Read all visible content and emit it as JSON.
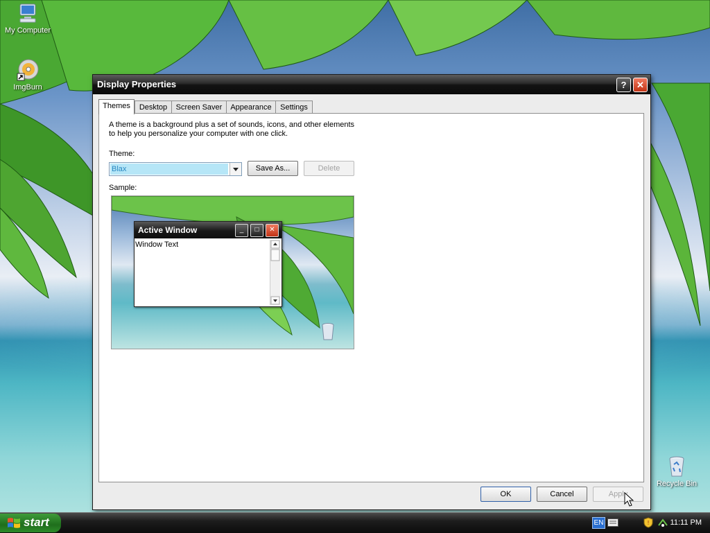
{
  "desktop": {
    "icons": [
      {
        "label": "My Computer",
        "icon": "my-computer-icon"
      },
      {
        "label": "ImgBurn",
        "icon": "imgburn-icon"
      },
      {
        "label": "Recycle Bin",
        "icon": "recycle-bin-icon"
      }
    ]
  },
  "dialog": {
    "title": "Display Properties",
    "help_glyph": "?",
    "close_glyph": "✕",
    "tabs": [
      {
        "label": "Themes",
        "active": true
      },
      {
        "label": "Desktop",
        "active": false
      },
      {
        "label": "Screen Saver",
        "active": false
      },
      {
        "label": "Appearance",
        "active": false
      },
      {
        "label": "Settings",
        "active": false
      }
    ],
    "description_line1": "A theme is a background plus a set of sounds, icons, and other elements",
    "description_line2": "to help you personalize your computer with one click.",
    "theme_label": "Theme:",
    "theme_value": "Blax",
    "save_as_label": "Save As...",
    "delete_label": "Delete",
    "sample_label": "Sample:",
    "sample": {
      "window_title": "Active Window",
      "window_text": "Window Text"
    },
    "ok_label": "OK",
    "cancel_label": "Cancel",
    "apply_label": "Apply"
  },
  "taskbar": {
    "start_label": "start",
    "language": "EN",
    "clock": "11:11 PM"
  },
  "colors": {
    "selection": "#b6e6f7",
    "close_red": "#c23315",
    "start_green": "#2d8b29"
  }
}
